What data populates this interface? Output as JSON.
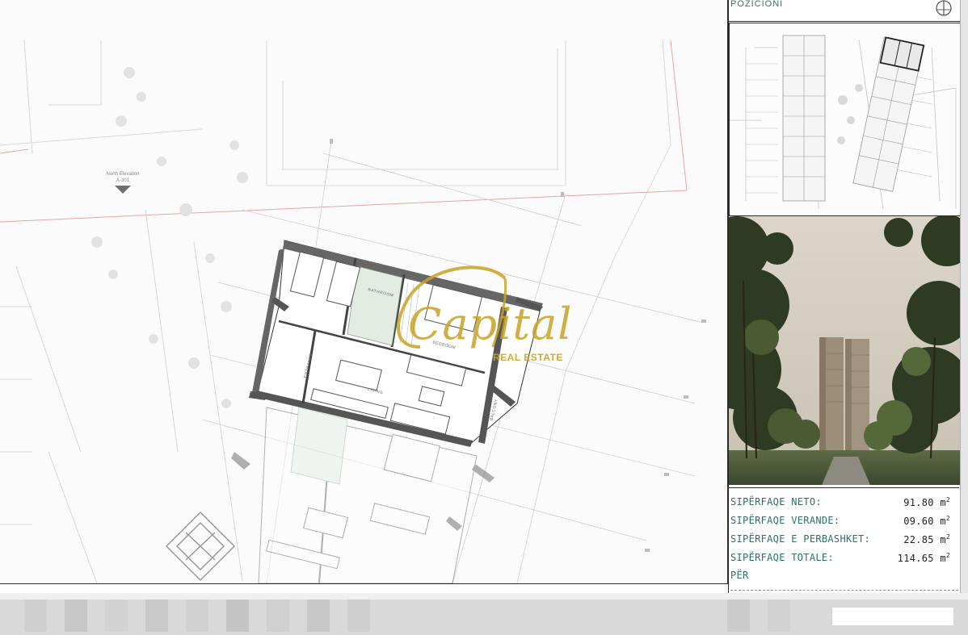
{
  "panel": {
    "title": "POZICIONI"
  },
  "plan": {
    "elevation_label": "North Elevation",
    "elevation_code": "A-301",
    "rooms": [
      "BATHROOM",
      "BEDROOM",
      "LIVING",
      "BALCONY",
      "ENTRANCE"
    ]
  },
  "logo": {
    "main": "Capital",
    "sub": "REAL ESTATE"
  },
  "areas": [
    {
      "label": "SIPËRFAQE NETO:",
      "value": "91.80 m",
      "unit_sup": "2"
    },
    {
      "label": "SIPËRFAQE VERANDE:",
      "value": "09.60 m",
      "unit_sup": "2"
    },
    {
      "label": "SIPËRFAQE E PERBASHKET:",
      "value": "22.85 m",
      "unit_sup": "2"
    },
    {
      "label": "SIPËRFAQE TOTALE:",
      "value": "114.65 m",
      "unit_sup": "2"
    },
    {
      "label": "PËR",
      "value": "",
      "unit_sup": ""
    }
  ],
  "colors": {
    "accent": "#2f6f69",
    "logo_gold": "#c9a227",
    "wall": "#555555"
  },
  "icons": [
    "north-arrow-icon",
    "elevation-marker-icon"
  ]
}
